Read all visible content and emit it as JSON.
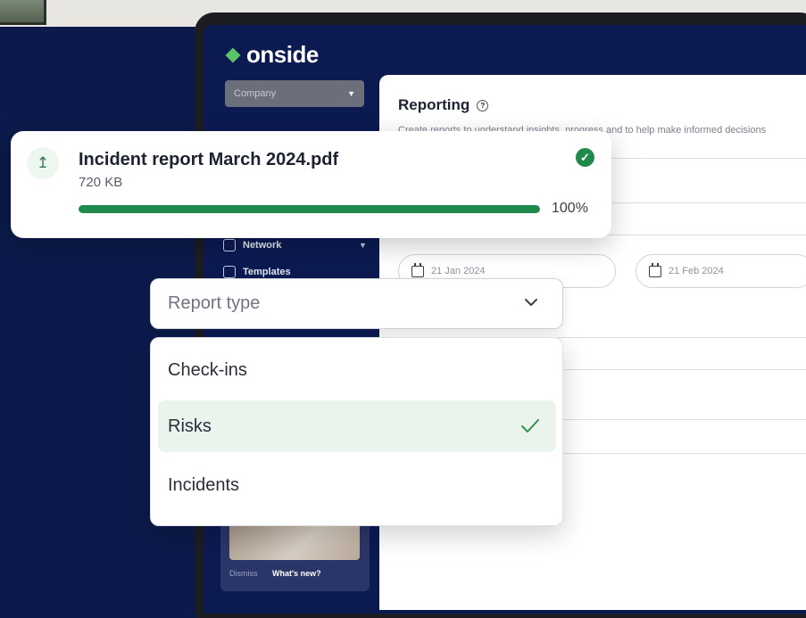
{
  "app": {
    "logo_text": "onside",
    "brand_green": "#1f8a4c",
    "navy": "#0c1a52"
  },
  "sidebar": {
    "company_select": {
      "value": "Company"
    },
    "items": [
      {
        "label": "Network",
        "icon": "users-icon",
        "expandable": true
      },
      {
        "label": "Templates",
        "icon": "document-icon",
        "expandable": false
      }
    ],
    "promo": {
      "dismiss_label": "Dismiss",
      "whatsnew_label": "What's new?"
    }
  },
  "main": {
    "title": "Reporting",
    "description": "Create reports to understand insights, progress and to help make informed decisions",
    "date_from": "21 Jan 2024",
    "date_to": "21 Feb 2024"
  },
  "upload": {
    "file_name": "Incident report March 2024.pdf",
    "file_size": "720 KB",
    "progress_label": "100%",
    "progress_value": 100,
    "status": "complete"
  },
  "report_type": {
    "placeholder": "Report type",
    "options": [
      {
        "label": "Check-ins",
        "selected": false
      },
      {
        "label": "Risks",
        "selected": true
      },
      {
        "label": "Incidents",
        "selected": false
      }
    ]
  }
}
